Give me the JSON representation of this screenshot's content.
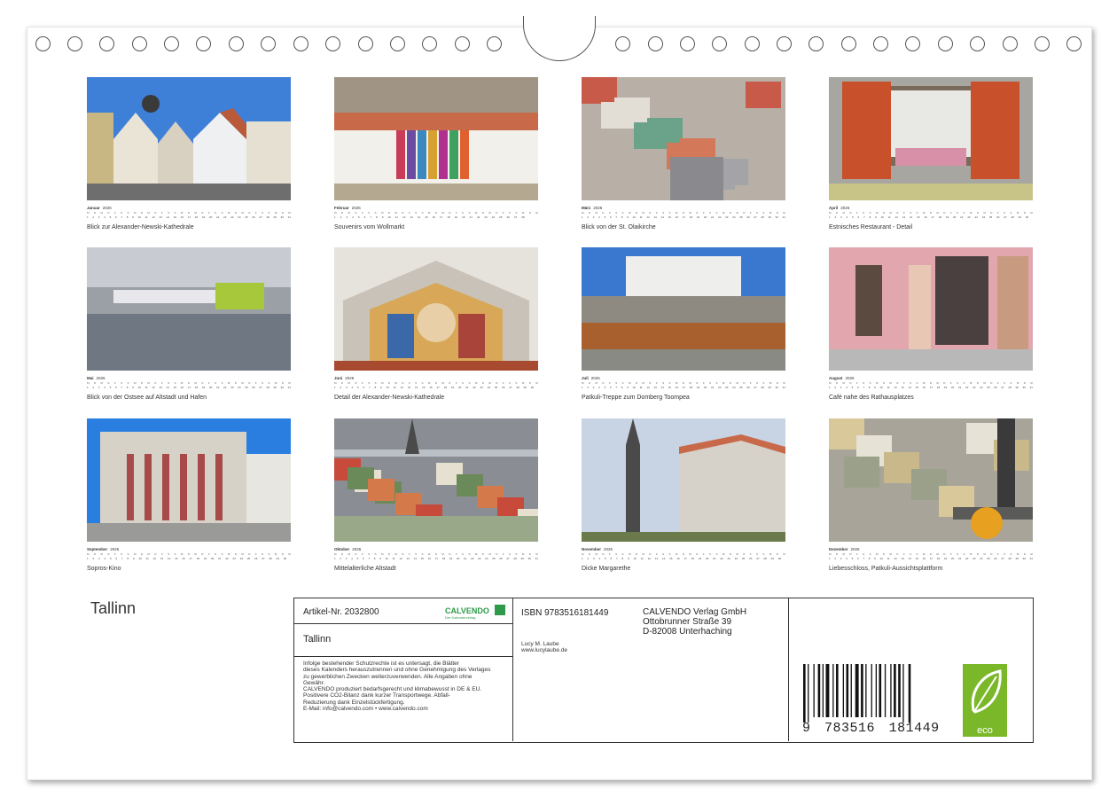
{
  "calendar_title": "Tallinn",
  "weekday_letters": [
    "M",
    "D",
    "M",
    "D",
    "F",
    "S",
    "S",
    "M",
    "D",
    "M",
    "D",
    "F",
    "S",
    "S",
    "M",
    "D",
    "M",
    "D",
    "F",
    "S",
    "S",
    "M",
    "D",
    "M",
    "D",
    "F",
    "S",
    "S",
    "M",
    "D",
    "M"
  ],
  "months": [
    {
      "name": "Januar",
      "year": "2026",
      "days": 31,
      "caption": "Blick zur Alexander-Newski-Kathedrale",
      "scene": "gables"
    },
    {
      "name": "Februar",
      "year": "2026",
      "days": 28,
      "caption": "Souvenirs vom Wollmarkt",
      "scene": "market"
    },
    {
      "name": "März",
      "year": "2026",
      "days": 31,
      "caption": "Blick von der St. Olaikirche",
      "scene": "rooftops"
    },
    {
      "name": "April",
      "year": "2026",
      "days": 30,
      "caption": "Estnisches Restaurant - Detail",
      "scene": "window"
    },
    {
      "name": "Mai",
      "year": "2026",
      "days": 31,
      "caption": "Blick von der Ostsee auf Altstadt und Hafen",
      "scene": "sea"
    },
    {
      "name": "Juni",
      "year": "2026",
      "days": 30,
      "caption": "Detail der Alexander-Newski-Kathedrale",
      "scene": "mosaic"
    },
    {
      "name": "Juli",
      "year": "2026",
      "days": 31,
      "caption": "Patkuli-Treppe zum Domberg Toompea",
      "scene": "palace"
    },
    {
      "name": "August",
      "year": "2026",
      "days": 31,
      "caption": "Café nahe des Rathausplatzes",
      "scene": "cafe"
    },
    {
      "name": "September",
      "year": "2026",
      "days": 30,
      "caption": "Sopros-Kino",
      "scene": "cinema"
    },
    {
      "name": "Oktober",
      "year": "2026",
      "days": 31,
      "caption": "Mittelalterliche Altstadt",
      "scene": "oldtown"
    },
    {
      "name": "November",
      "year": "2026",
      "days": 30,
      "caption": "Dicke Margarethe",
      "scene": "tower"
    },
    {
      "name": "Dezember",
      "year": "2026",
      "days": 31,
      "caption": "Liebesschloss, Patkuli-Aussichtsplattform",
      "scene": "lock"
    }
  ],
  "info": {
    "article": "Artikel-Nr. 2032800",
    "logo_text": "CALVENDO",
    "logo_sub": "Der Kalenderverlag",
    "title": "Tallinn",
    "legal": [
      "Infolge bestehender Schutzrechte ist es untersagt, die Blätter",
      "dieses Kalenders herauszutrennen und ohne Genehmigung des Verlages",
      "zu gewerblichen Zwecken weiterzuverwenden. Alle Angaben ohne",
      "Gewähr.",
      "CALVENDO produziert bedarfsgerecht und klimabewusst in DE & EU.",
      "Positivere CO2-Bilanz dank kurzer Transportwege. Abfall-",
      "Reduzierung dank Einzelstückfertigung.",
      "E-Mail: info@calvendo.com • www.calvendo.com"
    ],
    "isbn": "ISBN 9783516181449",
    "author": "Lucy M. Laube",
    "author_web": "www.lucylaube.de",
    "publisher": [
      "CALVENDO Verlag GmbH",
      "Ottobrunner Straße 39",
      "D-82008 Unterhaching"
    ],
    "barcode_digits": [
      "9",
      "783516",
      "181449"
    ],
    "eco_label": "eco"
  },
  "colors": {
    "eco_green": "#7ab829",
    "calvendo_green": "#2e9a4a",
    "frame": "#333333"
  }
}
